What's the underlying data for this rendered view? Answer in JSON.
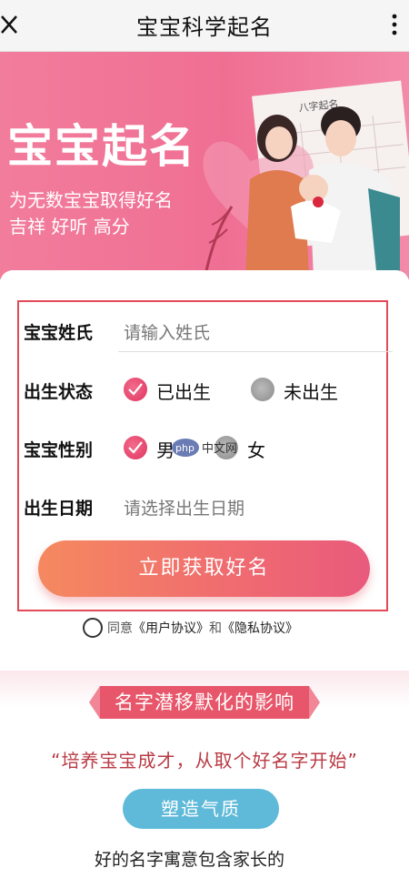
{
  "topbar": {
    "title": "宝宝科学起名"
  },
  "banner": {
    "headline": "宝宝起名",
    "line1": "为无数宝宝取得好名",
    "line2": "吉祥 好听 高分",
    "scroll_text": "八字起名"
  },
  "form": {
    "surname": {
      "label": "宝宝姓氏",
      "placeholder": "请输入姓氏"
    },
    "birth_status": {
      "label": "出生状态",
      "options": [
        "已出生",
        "未出生"
      ],
      "selected": "已出生"
    },
    "gender": {
      "label": "宝宝性别",
      "options": [
        "男",
        "女"
      ],
      "selected": "男"
    },
    "birth_date": {
      "label": "出生日期",
      "placeholder": "请选择出生日期"
    },
    "submit_label": "立即获取好名"
  },
  "agreement": {
    "prefix": "同意",
    "user": "《用户协议》",
    "and": "和",
    "privacy": "《隐私协议》"
  },
  "section": {
    "ribbon": "名字潜移默化的影响",
    "quote": "“培养宝宝成才，从取个好名字开始”",
    "pill": "塑造气质",
    "text": "好的名字寓意包含家长的"
  },
  "watermark": "php 中文网",
  "colors": {
    "brand_pink": "#ef6f93",
    "accent_red": "#e24a57",
    "pill_blue": "#5fb9d8"
  }
}
